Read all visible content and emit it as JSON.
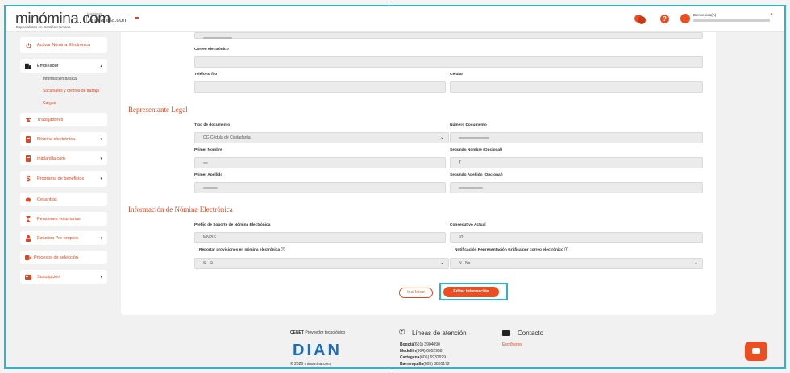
{
  "header": {
    "logo": "minómina.com",
    "logo_tagline": "Especialistas en Gestión Humana",
    "product_small": "Módulo de",
    "product": "miplanilla.com",
    "welcome": "Bienvenido(A)"
  },
  "sidebar": {
    "items": [
      {
        "label": "Activar Nómina Electrónica",
        "icon": "power-icon"
      },
      {
        "label": "Empleador",
        "icon": "building-icon"
      },
      {
        "label": "Trabajadores",
        "icon": "people-icon"
      },
      {
        "label": "Nómina electrónica",
        "icon": "document-icon"
      },
      {
        "label": "miplanilla.com",
        "icon": "document-icon"
      },
      {
        "label": "Programa de beneficios",
        "icon": "dollar-icon"
      },
      {
        "label": "Cesantías",
        "icon": "piggy-bank-icon"
      },
      {
        "label": "Pensiones voluntarias",
        "icon": "hourglass-icon"
      },
      {
        "label": "Estudios Pre-empleo",
        "icon": "person-icon"
      },
      {
        "label": "Procesos de selección",
        "icon": "video-icon"
      },
      {
        "label": "Suscripción",
        "icon": "card-icon"
      }
    ],
    "empleador_sub": [
      "Información básica",
      "Sucursales y centros de trabajo",
      "Cargos"
    ]
  },
  "form": {
    "correo_label": "Correo electrónico",
    "telefono_label": "Teléfono fijo",
    "celular_label": "Celular",
    "rep_title": "Representante Legal",
    "tipo_doc_label": "Tipo de documento",
    "tipo_doc_value": "CC-Cédula de Ciudadanía",
    "num_doc_label": "Número Documento",
    "primer_nombre_label": "Primer Nombre",
    "segundo_nombre_label": "Segundo Nombre (Opcional)",
    "segundo_nombre_value": "T",
    "primer_apellido_label": "Primer Apellido",
    "segundo_apellido_label": "Segundo Apellido (Opcional)",
    "ne_title": "Información de Nómina Electrónica",
    "prefijo_label": "Prefijo de Soporte de Nómina Electrónica",
    "prefijo_value": "MNPIS",
    "consecutivo_label": "Consecutivo Actual",
    "consecutivo_value": "92",
    "provisiones_label": "Reportar provisiones en nómina electrónica",
    "provisiones_value": "S - Si",
    "notificacion_label": "Notificación Representación Gráfica por correo electrónico",
    "notificacion_value": "N - No",
    "btn_back": "Ir al Inicio",
    "btn_edit": "Editar información"
  },
  "footer": {
    "cenet": "CENET",
    "cenet_rest": "Proveedor tecnológico",
    "dian": "DIAN",
    "copyright": "© 2026 minomina.com",
    "lineas": "Líneas de atención",
    "phones": [
      {
        "city": "Bogotá",
        "num": "(601) 3904090"
      },
      {
        "city": "Medellín",
        "num": "(604) 6052958"
      },
      {
        "city": "Cartagena",
        "num": "(605) 6932929"
      },
      {
        "city": "Barranquilla",
        "num": "(605) 3855172"
      }
    ],
    "contacto": "Contacto",
    "escribenos": "Escríbenos"
  },
  "colors": {
    "accent": "#e2461d",
    "highlight": "#30b1cf"
  }
}
